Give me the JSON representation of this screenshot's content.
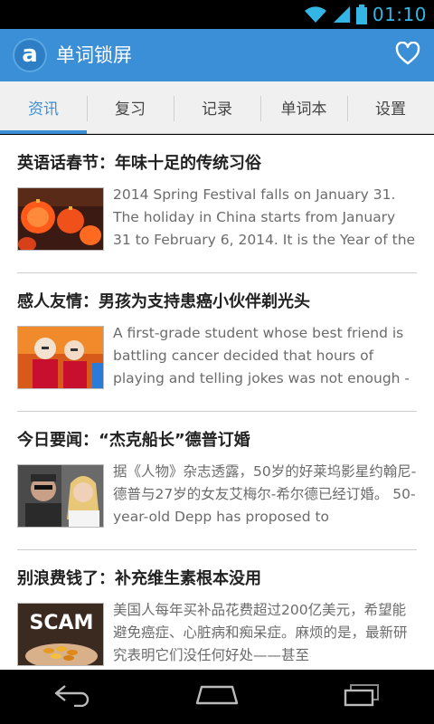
{
  "status_bar": {
    "time": "01:10"
  },
  "app_bar": {
    "logo_letter": "a",
    "title": "单词锁屏",
    "favorite_icon": "heart-icon"
  },
  "tabs": [
    {
      "label": "资讯",
      "active": true
    },
    {
      "label": "复习",
      "active": false
    },
    {
      "label": "记录",
      "active": false
    },
    {
      "label": "单词本",
      "active": false
    },
    {
      "label": "设置",
      "active": false
    }
  ],
  "articles": [
    {
      "title": "英语话春节：年味十足的传统习俗",
      "snippet": "2014 Spring Festival falls on January 31. The holiday in China starts from January 31 to February 6, 2014. It is the Year of the"
    },
    {
      "title": "感人友情：男孩为支持患癌小伙伴剃光头",
      "snippet": "A first-grade student whose best friend is battling cancer decided that hours of playing and telling jokes was not enough -"
    },
    {
      "title": "今日要闻：“杰克船长”德普订婚",
      "snippet": "据《人物》杂志透露，50岁的好莱坞影星约翰尼-德普与27岁的女友艾梅尔-希尔德已经订婚。 50-year-old Depp has proposed to"
    },
    {
      "title": "别浪费钱了：补充维生素根本没用",
      "snippet": "美国人每年买补品花费超过200亿美元，希望能避免癌症、心脏病和痴呆症。麻烦的是，最新研究表明它们没任何好处——甚至"
    }
  ],
  "thumb4_text": "SCAM",
  "colors": {
    "accent": "#3b8fd6",
    "status_time": "#33b5e5"
  }
}
